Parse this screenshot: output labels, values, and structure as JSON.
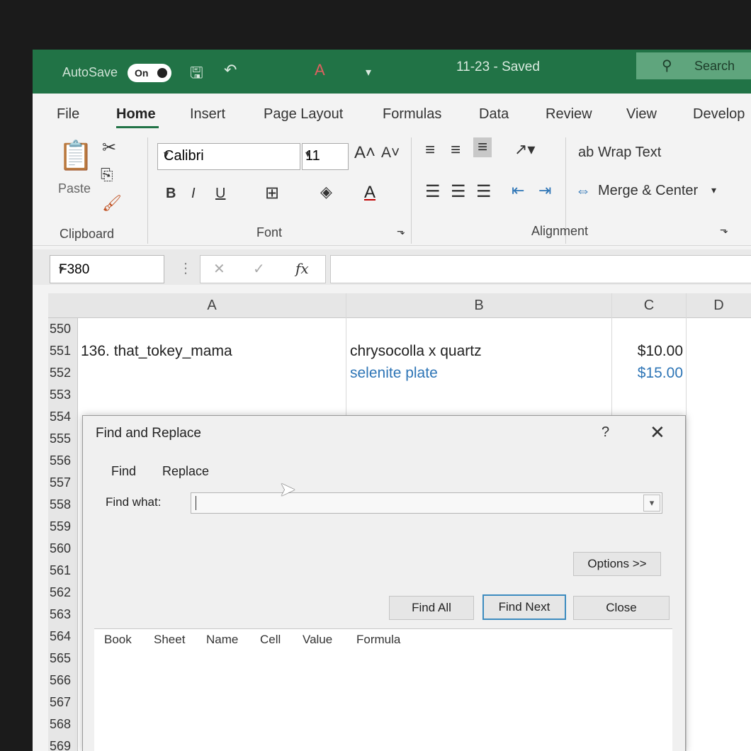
{
  "titlebar": {
    "autosave_label": "AutoSave",
    "autosave_state": "On",
    "doc_title": "11-23 - Saved",
    "search_label": "Search"
  },
  "ribbon_tabs": [
    "File",
    "Home",
    "Insert",
    "Page Layout",
    "Formulas",
    "Data",
    "Review",
    "View",
    "Develop"
  ],
  "active_tab": "Home",
  "ribbon": {
    "paste_label": "Paste",
    "clipboard_label": "Clipboard",
    "font_name": "Calibri",
    "font_size": "11",
    "font_label": "Font",
    "bold": "B",
    "italic": "I",
    "underline": "U",
    "wrap_text": "Wrap Text",
    "merge_center": "Merge & Center",
    "alignment_label": "Alignment"
  },
  "formula_bar": {
    "name_box": "F380",
    "fx": "fx",
    "formula": ""
  },
  "columns": [
    "A",
    "B",
    "C",
    "D"
  ],
  "rows": [
    {
      "num": "550",
      "a": "",
      "b": "",
      "c": "",
      "color": "#222"
    },
    {
      "num": "551",
      "a": "136. that_tokey_mama",
      "b": "chrysocolla x quartz",
      "c": "$10.00",
      "color": "#222"
    },
    {
      "num": "552",
      "a": "",
      "b": "selenite plate",
      "c": "$15.00",
      "color": "#2e75b6"
    },
    {
      "num": "553",
      "a": "",
      "b": "",
      "c": "",
      "color": "#222"
    },
    {
      "num": "554"
    },
    {
      "num": "555"
    },
    {
      "num": "556"
    },
    {
      "num": "557"
    },
    {
      "num": "558"
    },
    {
      "num": "559"
    },
    {
      "num": "560"
    },
    {
      "num": "561"
    },
    {
      "num": "562"
    },
    {
      "num": "563"
    },
    {
      "num": "564"
    },
    {
      "num": "565"
    },
    {
      "num": "566"
    },
    {
      "num": "567"
    },
    {
      "num": "568"
    },
    {
      "num": "569"
    }
  ],
  "dialog": {
    "title": "Find and Replace",
    "help": "?",
    "close": "✕",
    "tab_find": "Find",
    "tab_replace": "Replace",
    "find_what_label": "Find what:",
    "find_what_value": "",
    "options_button": "Options >>",
    "find_all_button": "Find All",
    "find_next_button": "Find Next",
    "close_button": "Close",
    "result_columns": [
      "Book",
      "Sheet",
      "Name",
      "Cell",
      "Value",
      "Formula"
    ]
  }
}
